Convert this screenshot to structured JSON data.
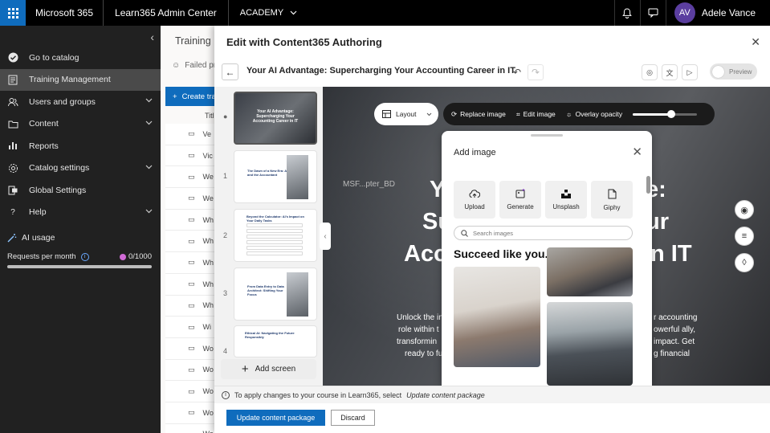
{
  "topbar": {
    "product": "Microsoft 365",
    "app": "Learn365 Admin Center",
    "academy": "ACADEMY",
    "user_initials": "AV",
    "user_name": "Adele Vance"
  },
  "sidebar": {
    "items": [
      {
        "label": "Go to catalog"
      },
      {
        "label": "Training Management"
      },
      {
        "label": "Users and groups"
      },
      {
        "label": "Content"
      },
      {
        "label": "Reports"
      },
      {
        "label": "Catalog settings"
      },
      {
        "label": "Global Settings"
      },
      {
        "label": "Help"
      }
    ],
    "ai_usage": "AI usage",
    "requests_label": "Requests per month",
    "requests_count": "0/1000",
    "requests_used": 0,
    "requests_limit": 1000
  },
  "background": {
    "title": "Training M",
    "failed": "Failed pro",
    "create": "Create tra",
    "column": "Titl",
    "rows": [
      "Ve",
      "Vic",
      "We",
      "We",
      "Wh",
      "Wh",
      "Wh",
      "Wh",
      "Wh",
      "Wi",
      "Wo",
      "Wo",
      "Wo",
      "Wo",
      "Wo"
    ]
  },
  "panel": {
    "title": "Edit with Content365 Authoring",
    "course_title": "Your AI Advantage: Supercharging Your Accounting Career in IT",
    "preview": "Preview",
    "thumbnails": [
      {
        "num": "",
        "title": "Your AI Advantage: Supercharging Your Accounting Career in IT"
      },
      {
        "num": "1",
        "title": "The Dawn of a New Era: A and the Accountant"
      },
      {
        "num": "2",
        "title": "Beyond the Calculator: AI's Impact on Your Daily Tasks"
      },
      {
        "num": "3",
        "title": "From Data Entry to Data Architect: Shifting Your Focus"
      },
      {
        "num": "4",
        "title": "Ethical AI: Navigating the Future Responsibly"
      }
    ],
    "add_screen": "Add screen",
    "info": "To apply changes to your course in Learn365, select",
    "info_em": "Update content package",
    "update_button": "Update content package",
    "discard_button": "Discard"
  },
  "canvas": {
    "layout_label": "Layout",
    "replace_image": "Replace image",
    "edit_image": "Edit image",
    "overlay_opacity": "Overlay opacity",
    "overlay_value": 0.6,
    "watermark": "MSF...pter_BD",
    "heading_lines": [
      "Yo",
      "e:",
      "Su",
      "ur",
      "Acc",
      "n IT"
    ],
    "body_left": [
      "Unlock the in",
      "role within t",
      "transformin",
      "ready to fu"
    ],
    "body_right": [
      "r accounting",
      "owerful ally,",
      "impact. Get",
      "g financial"
    ]
  },
  "add_image": {
    "title": "Add image",
    "tiles": [
      "Upload",
      "Generate",
      "Unsplash",
      "Giphy"
    ],
    "search_placeholder": "Search images",
    "promo_text": "Succeed like you."
  }
}
